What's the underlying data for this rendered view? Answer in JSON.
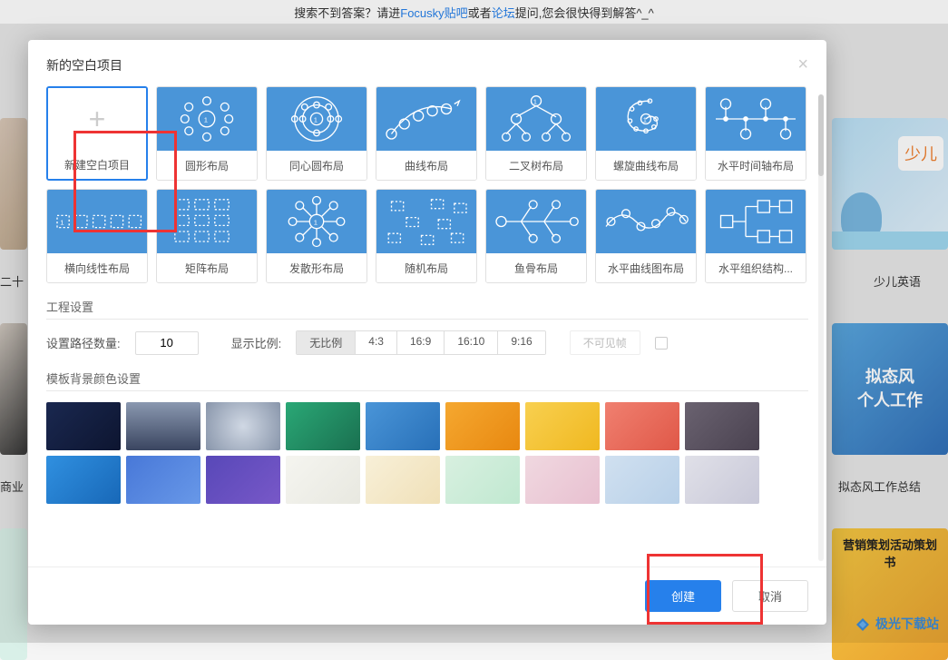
{
  "top_hint": {
    "prefix": "搜索不到答案？请进",
    "link1": "Focusky贴吧",
    "mid": "或者",
    "link2": "论坛",
    "suffix": "提问,您会很快得到解答^_^"
  },
  "bg_cards": {
    "right1_bubble": "少儿",
    "right1_label": "少儿英语",
    "right2_line1": "拟态风",
    "right2_line2": "个人工作",
    "right2_label": "拟态风工作总结",
    "right3_title": "营销策划活动策划书",
    "left1_label": "二十",
    "left2_label": "商业"
  },
  "watermark": "极光下载站",
  "modal": {
    "title": "新的空白项目",
    "layouts": [
      {
        "key": "blank",
        "label": "新建空白项目"
      },
      {
        "key": "circle",
        "label": "圆形布局"
      },
      {
        "key": "concentric",
        "label": "同心圆布局"
      },
      {
        "key": "curve",
        "label": "曲线布局"
      },
      {
        "key": "binary",
        "label": "二叉树布局"
      },
      {
        "key": "spiral",
        "label": "螺旋曲线布局"
      },
      {
        "key": "htimeline",
        "label": "水平时间轴布局"
      },
      {
        "key": "hlinear",
        "label": "横向线性布局"
      },
      {
        "key": "matrix",
        "label": "矩阵布局"
      },
      {
        "key": "radial",
        "label": "发散形布局"
      },
      {
        "key": "random",
        "label": "随机布局"
      },
      {
        "key": "fishbone",
        "label": "鱼骨布局"
      },
      {
        "key": "hcurvechart",
        "label": "水平曲线图布局"
      },
      {
        "key": "horg",
        "label": "水平组织结构..."
      }
    ],
    "project_settings": {
      "title": "工程设置",
      "path_count_label": "设置路径数量:",
      "path_count_value": "10",
      "ratio_label": "显示比例:",
      "ratios": [
        "无比例",
        "4:3",
        "16:9",
        "16:10",
        "9:16"
      ],
      "ratio_active": "无比例",
      "invisible_frame": "不可见帧"
    },
    "bg_colors": {
      "title": "模板背景颜色设置",
      "row1": [
        "linear-gradient(135deg,#1a2850,#0d1530)",
        "linear-gradient(180deg,#8a98b0,#3a4560)",
        "radial-gradient(circle,#d0d8e4,#8895aa)",
        "linear-gradient(135deg,#2aa876,#1a7050)",
        "linear-gradient(135deg,#4a95d8,#2870b8)",
        "linear-gradient(135deg,#f5a830,#e88810)",
        "linear-gradient(135deg,#f8d050,#f0b820)",
        "linear-gradient(135deg,#f08070,#e05848)",
        "linear-gradient(135deg,#6a6270,#4a4250)"
      ],
      "row2": [
        "linear-gradient(135deg,#3090e0,#1868b8)",
        "linear-gradient(135deg,#4878d8,#6898e8)",
        "linear-gradient(135deg,#5848b8,#7858c8)",
        "linear-gradient(135deg,#f5f5f0,#e8e8e0)",
        "linear-gradient(135deg,#f8f0d8,#f0e0b8)",
        "linear-gradient(135deg,#d8f0e0,#c0e8d0)",
        "linear-gradient(135deg,#f0d8e0,#e8c0d0)",
        "linear-gradient(135deg,#d0e0f0,#b8d0e8)",
        "linear-gradient(135deg,#e0e0e8,#c8c8d8)"
      ]
    },
    "buttons": {
      "create": "创建",
      "cancel": "取消"
    }
  }
}
